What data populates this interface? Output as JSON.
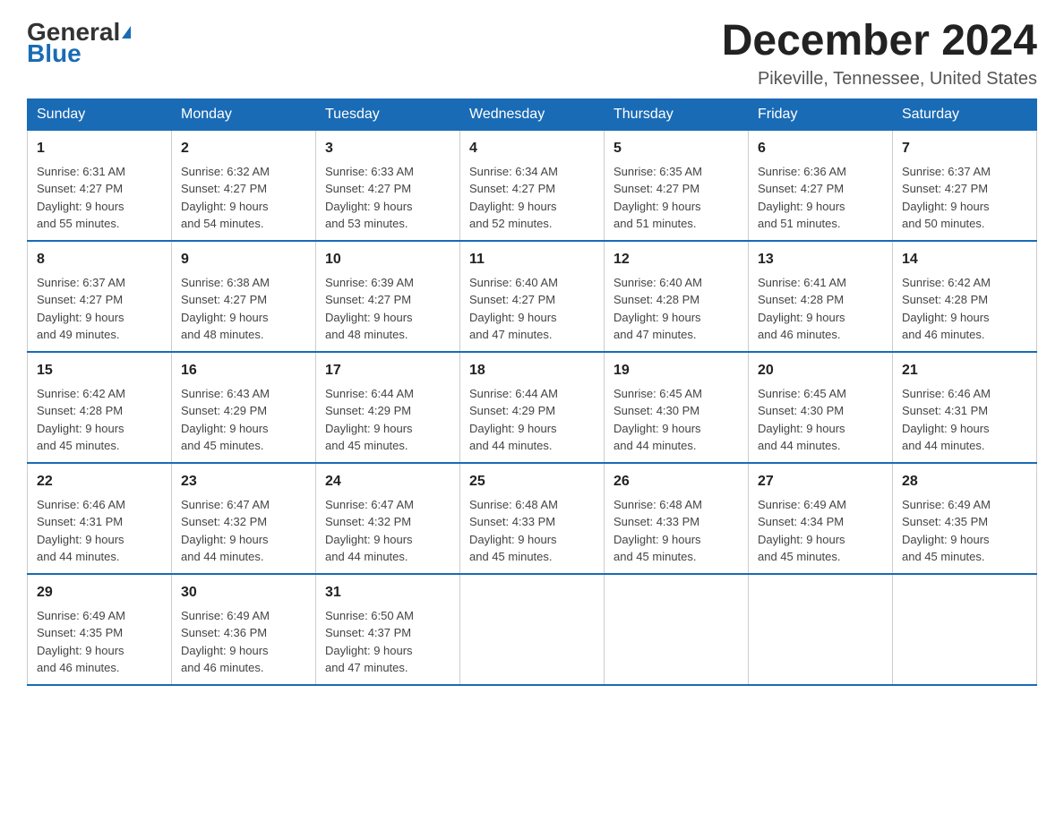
{
  "header": {
    "logo_general": "General",
    "logo_blue": "Blue",
    "month_title": "December 2024",
    "location": "Pikeville, Tennessee, United States"
  },
  "weekdays": [
    "Sunday",
    "Monday",
    "Tuesday",
    "Wednesday",
    "Thursday",
    "Friday",
    "Saturday"
  ],
  "weeks": [
    [
      {
        "day": "1",
        "sunrise": "6:31 AM",
        "sunset": "4:27 PM",
        "daylight": "9 hours and 55 minutes."
      },
      {
        "day": "2",
        "sunrise": "6:32 AM",
        "sunset": "4:27 PM",
        "daylight": "9 hours and 54 minutes."
      },
      {
        "day": "3",
        "sunrise": "6:33 AM",
        "sunset": "4:27 PM",
        "daylight": "9 hours and 53 minutes."
      },
      {
        "day": "4",
        "sunrise": "6:34 AM",
        "sunset": "4:27 PM",
        "daylight": "9 hours and 52 minutes."
      },
      {
        "day": "5",
        "sunrise": "6:35 AM",
        "sunset": "4:27 PM",
        "daylight": "9 hours and 51 minutes."
      },
      {
        "day": "6",
        "sunrise": "6:36 AM",
        "sunset": "4:27 PM",
        "daylight": "9 hours and 51 minutes."
      },
      {
        "day": "7",
        "sunrise": "6:37 AM",
        "sunset": "4:27 PM",
        "daylight": "9 hours and 50 minutes."
      }
    ],
    [
      {
        "day": "8",
        "sunrise": "6:37 AM",
        "sunset": "4:27 PM",
        "daylight": "9 hours and 49 minutes."
      },
      {
        "day": "9",
        "sunrise": "6:38 AM",
        "sunset": "4:27 PM",
        "daylight": "9 hours and 48 minutes."
      },
      {
        "day": "10",
        "sunrise": "6:39 AM",
        "sunset": "4:27 PM",
        "daylight": "9 hours and 48 minutes."
      },
      {
        "day": "11",
        "sunrise": "6:40 AM",
        "sunset": "4:27 PM",
        "daylight": "9 hours and 47 minutes."
      },
      {
        "day": "12",
        "sunrise": "6:40 AM",
        "sunset": "4:28 PM",
        "daylight": "9 hours and 47 minutes."
      },
      {
        "day": "13",
        "sunrise": "6:41 AM",
        "sunset": "4:28 PM",
        "daylight": "9 hours and 46 minutes."
      },
      {
        "day": "14",
        "sunrise": "6:42 AM",
        "sunset": "4:28 PM",
        "daylight": "9 hours and 46 minutes."
      }
    ],
    [
      {
        "day": "15",
        "sunrise": "6:42 AM",
        "sunset": "4:28 PM",
        "daylight": "9 hours and 45 minutes."
      },
      {
        "day": "16",
        "sunrise": "6:43 AM",
        "sunset": "4:29 PM",
        "daylight": "9 hours and 45 minutes."
      },
      {
        "day": "17",
        "sunrise": "6:44 AM",
        "sunset": "4:29 PM",
        "daylight": "9 hours and 45 minutes."
      },
      {
        "day": "18",
        "sunrise": "6:44 AM",
        "sunset": "4:29 PM",
        "daylight": "9 hours and 44 minutes."
      },
      {
        "day": "19",
        "sunrise": "6:45 AM",
        "sunset": "4:30 PM",
        "daylight": "9 hours and 44 minutes."
      },
      {
        "day": "20",
        "sunrise": "6:45 AM",
        "sunset": "4:30 PM",
        "daylight": "9 hours and 44 minutes."
      },
      {
        "day": "21",
        "sunrise": "6:46 AM",
        "sunset": "4:31 PM",
        "daylight": "9 hours and 44 minutes."
      }
    ],
    [
      {
        "day": "22",
        "sunrise": "6:46 AM",
        "sunset": "4:31 PM",
        "daylight": "9 hours and 44 minutes."
      },
      {
        "day": "23",
        "sunrise": "6:47 AM",
        "sunset": "4:32 PM",
        "daylight": "9 hours and 44 minutes."
      },
      {
        "day": "24",
        "sunrise": "6:47 AM",
        "sunset": "4:32 PM",
        "daylight": "9 hours and 44 minutes."
      },
      {
        "day": "25",
        "sunrise": "6:48 AM",
        "sunset": "4:33 PM",
        "daylight": "9 hours and 45 minutes."
      },
      {
        "day": "26",
        "sunrise": "6:48 AM",
        "sunset": "4:33 PM",
        "daylight": "9 hours and 45 minutes."
      },
      {
        "day": "27",
        "sunrise": "6:49 AM",
        "sunset": "4:34 PM",
        "daylight": "9 hours and 45 minutes."
      },
      {
        "day": "28",
        "sunrise": "6:49 AM",
        "sunset": "4:35 PM",
        "daylight": "9 hours and 45 minutes."
      }
    ],
    [
      {
        "day": "29",
        "sunrise": "6:49 AM",
        "sunset": "4:35 PM",
        "daylight": "9 hours and 46 minutes."
      },
      {
        "day": "30",
        "sunrise": "6:49 AM",
        "sunset": "4:36 PM",
        "daylight": "9 hours and 46 minutes."
      },
      {
        "day": "31",
        "sunrise": "6:50 AM",
        "sunset": "4:37 PM",
        "daylight": "9 hours and 47 minutes."
      },
      null,
      null,
      null,
      null
    ]
  ]
}
